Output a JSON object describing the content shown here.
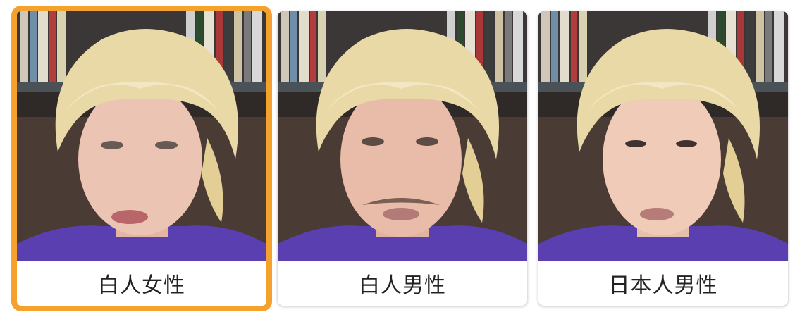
{
  "cards": [
    {
      "label": "白人女性",
      "selected": true
    },
    {
      "label": "白人男性",
      "selected": false
    },
    {
      "label": "日本人男性",
      "selected": false
    }
  ],
  "colors": {
    "selection_outline": "#f4a22d",
    "shirt": "#5a3fb0",
    "hair": "#e9d9a6",
    "sofa": "#4a3b34",
    "shelf": "#3a3a3a"
  }
}
